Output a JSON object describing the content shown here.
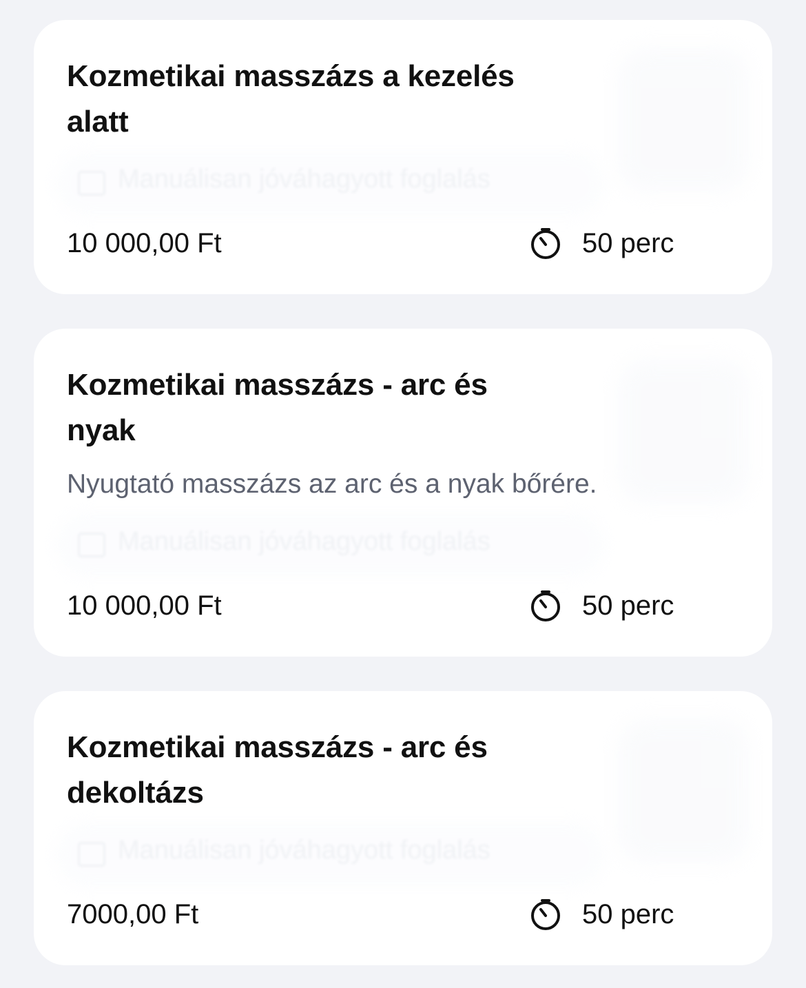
{
  "services": [
    {
      "title": "Kozmetikai masszázs a kezelés alatt",
      "description": "",
      "badge": "Manuálisan jóváhagyott foglalás",
      "price": "10 000,00 Ft",
      "duration": "50 perc",
      "duration_icon": "timer-icon"
    },
    {
      "title": "Kozmetikai masszázs - arc és nyak",
      "description": "Nyugtató masszázs az arc és a nyak bőrére.",
      "badge": "Manuálisan jóváhagyott foglalás",
      "price": "10 000,00 Ft",
      "duration": "50 perc",
      "duration_icon": "timer-icon"
    },
    {
      "title": "Kozmetikai masszázs - arc és dekoltázs",
      "description": "",
      "badge": "Manuálisan jóváhagyott foglalás",
      "price": "7000,00 Ft",
      "duration": "50 perc",
      "duration_icon": "timer-icon"
    }
  ],
  "colors": {
    "background": "#f2f3f7",
    "card": "#ffffff",
    "text": "#111111",
    "description": "#5d6270"
  }
}
